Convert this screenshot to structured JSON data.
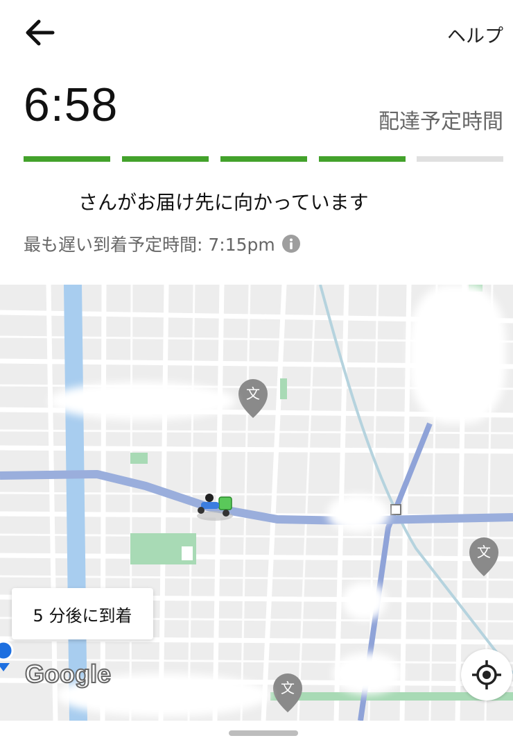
{
  "header": {
    "back_icon": "back-arrow-icon",
    "help_label": "ヘルプ"
  },
  "eta": {
    "time": "6:58",
    "label": "配達予定時間"
  },
  "progress": {
    "segments_total": 5,
    "segments_completed": 4,
    "active_color": "#43a22b",
    "inactive_color": "#e0e0e0"
  },
  "status": {
    "message": "さんがお届け先に向かっています",
    "latest_label": "最も遅い到着予定時間: 7:15pm",
    "info_icon": "info-icon"
  },
  "map": {
    "arrival_label": "5 分後に到着",
    "school_marker_glyph": "文",
    "attribution": "Google",
    "locate_icon": "my-location-icon",
    "route_color": "#9aaedc",
    "courier_icon": "delivery-scooter-icon"
  }
}
